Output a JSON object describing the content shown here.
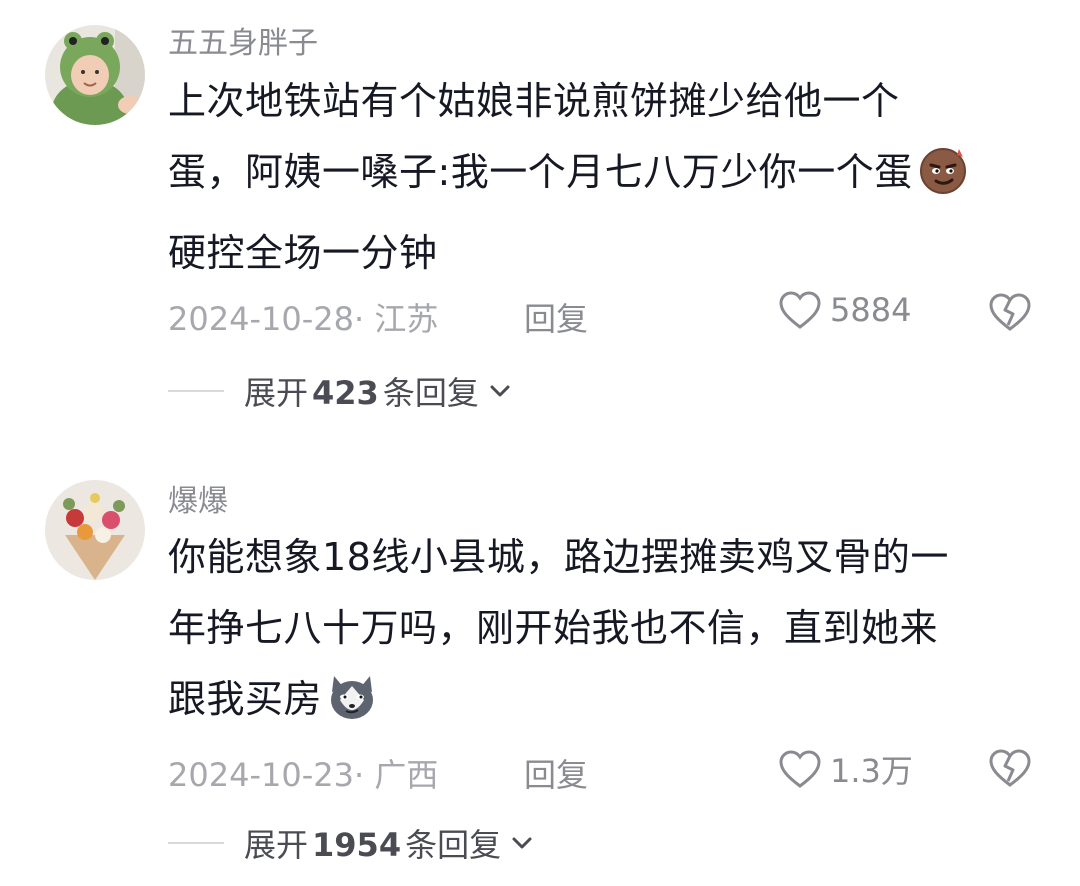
{
  "comments": [
    {
      "username": "五五身胖子",
      "avatar_icon": "frog-costume-baby-avatar",
      "lines": [
        "上次地铁站有个姑娘非说煎饼摊少给他一个",
        "蛋，阿姨一嗓子:我一个月七八万少你一个蛋",
        "硬控全场一分钟"
      ],
      "emoji_icon": "smug-face-emoji",
      "date": "2024-10-28· 江苏",
      "reply_label": "回复",
      "likes": "5884",
      "expand_prefix": "展开",
      "expand_count": "423",
      "expand_suffix": "条回复"
    },
    {
      "username": "爆爆",
      "avatar_icon": "flower-bouquet-avatar",
      "lines": [
        "你能想象18线小县城，路边摆摊卖鸡叉骨的一",
        "年挣七八十万吗，刚开始我也不信，直到她来",
        "跟我买房"
      ],
      "emoji_icon": "husky-dog-emoji",
      "date": "2024-10-23· 广西",
      "reply_label": "回复",
      "likes": "1.3万",
      "expand_prefix": "展开",
      "expand_count": "1954",
      "expand_suffix": "条回复"
    }
  ],
  "colors": {
    "text": "#161823",
    "secondary": "#8a8b91",
    "tertiary": "#a7a8ad"
  }
}
